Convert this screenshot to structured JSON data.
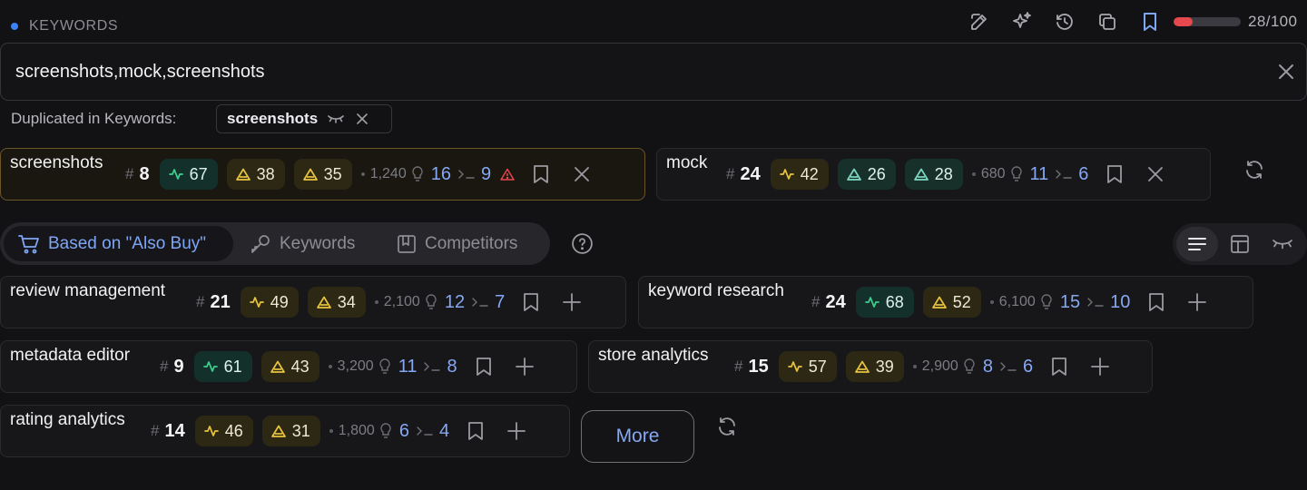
{
  "header": {
    "section_label": "KEYWORDS",
    "usage_text": "28/100",
    "usage_fraction": 0.28,
    "toolbar_icons": [
      "edit-icon",
      "sparkles-icon",
      "history-icon",
      "copy-icon",
      "bookmark-icon"
    ]
  },
  "input": {
    "value": "screenshots,mock,screenshots"
  },
  "duplicates": {
    "label": "Duplicated in Keywords:",
    "chip": "screenshots"
  },
  "keywords": [
    {
      "name": "screenshots",
      "rank": "8",
      "pill1": "67",
      "pill2": "38",
      "pill3": "35",
      "volume": "1,240",
      "ideas": "16",
      "terms": "9",
      "warning": true
    },
    {
      "name": "mock",
      "rank": "24",
      "pill1": "42",
      "pill2": "26",
      "pill3": "28",
      "volume": "680",
      "ideas": "11",
      "terms": "6"
    }
  ],
  "tabs": [
    {
      "label": "Based on \"Also Buy\"",
      "icon": "cart-icon",
      "active": true
    },
    {
      "label": "Keywords",
      "icon": "key-icon"
    },
    {
      "label": "Competitors",
      "icon": "book-icon"
    }
  ],
  "view_modes": [
    "list-view-icon",
    "grid-view-icon",
    "hidden-view-icon"
  ],
  "suggestions": [
    {
      "name": "review management",
      "rank": "21",
      "pill1": "49",
      "pill2": "34",
      "volume": "2,100",
      "ideas": "12",
      "terms": "7"
    },
    {
      "name": "keyword research",
      "rank": "24",
      "pill1": "68",
      "pill2": "52",
      "volume": "6,100",
      "ideas": "15",
      "terms": "10"
    },
    {
      "name": "metadata editor",
      "rank": "9",
      "pill1": "61",
      "pill2": "43",
      "volume": "3,200",
      "ideas": "11",
      "terms": "8"
    },
    {
      "name": "store analytics",
      "rank": "15",
      "pill1": "57",
      "pill2": "39",
      "volume": "2,900",
      "ideas": "8",
      "terms": "6"
    },
    {
      "name": "rating analytics",
      "rank": "14",
      "pill1": "46",
      "pill2": "31",
      "volume": "1,800",
      "ideas": "6",
      "terms": "4"
    }
  ],
  "more_label": "More",
  "colors": {
    "accent_blue": "#86a8f3",
    "green": "#3ecf8e",
    "yellow": "#e8c33e",
    "teal": "#7ed9c3",
    "danger": "#e5484d"
  }
}
